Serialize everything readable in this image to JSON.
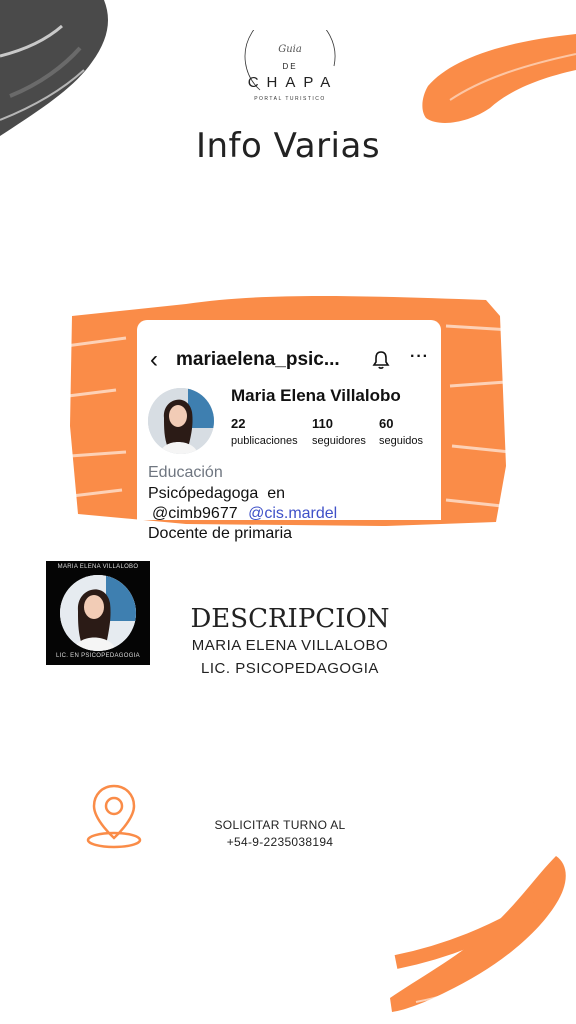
{
  "logo": {
    "script": "Guia",
    "de": "DE",
    "name": "CHAPA",
    "tagline": "PORTAL TURISTICO"
  },
  "page_title": "Info Varias",
  "instagram": {
    "username": "mariaelena_psic...",
    "display_name": "Maria Elena Villalobo",
    "stats": [
      {
        "value": "22",
        "label": "publicaciones"
      },
      {
        "value": "110",
        "label": "seguidores"
      },
      {
        "value": "60",
        "label": "seguidos"
      }
    ],
    "bio_category": "Educación",
    "bio_line1": "Psicópedagoga  en",
    "bio_mention1": "@cimb9677",
    "bio_mention2": "@cis.mardel",
    "bio_line3": "Docente de primaria"
  },
  "thumbnail": {
    "top_text": "MARIA ELENA VILLALOBO",
    "bottom_text": "LIC. EN PSICOPEDAGOGIA"
  },
  "description": {
    "title": "DESCRIPCION",
    "line1": "MARIA ELENA VILLALOBO",
    "line2": "LIC. PSICOPEDAGOGIA"
  },
  "contact": {
    "line1": "SOLICITAR TURNO AL",
    "phone": "+54-9-2235038194"
  },
  "colors": {
    "accent": "#fa8c48",
    "dark_stroke": "#4a4a4a",
    "link": "#3f51c8"
  },
  "icons": [
    "location-pin-icon",
    "bell-icon",
    "back-chevron-icon",
    "more-icon"
  ]
}
